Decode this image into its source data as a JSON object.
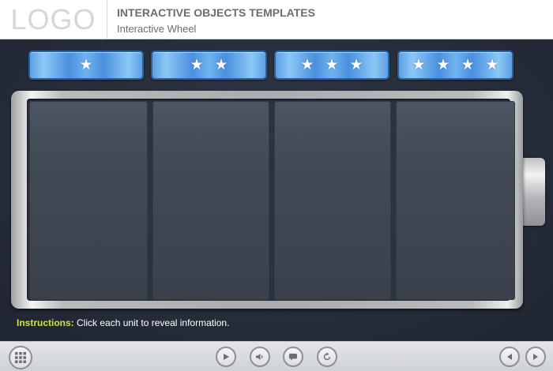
{
  "header": {
    "logo_text": "LOGO",
    "title": "INTERACTIVE OBJECTS TEMPLATES",
    "subtitle": "Interactive Wheel"
  },
  "tabs": [
    {
      "stars": 1
    },
    {
      "stars": 2
    },
    {
      "stars": 3
    },
    {
      "stars": 4
    }
  ],
  "battery": {
    "cells": 4
  },
  "instructions": {
    "label": "Instructions:",
    "text": "Click each unit to reveal information."
  },
  "controls": {
    "icons": [
      "grid-menu-icon",
      "play-icon",
      "audio-icon",
      "captions-icon",
      "replay-icon",
      "prev-arrow-icon",
      "next-arrow-icon"
    ]
  },
  "colors": {
    "tab_blue": "#4a90dd",
    "instructions_label": "#c6e64a",
    "stage_bg": "#2a3140"
  }
}
